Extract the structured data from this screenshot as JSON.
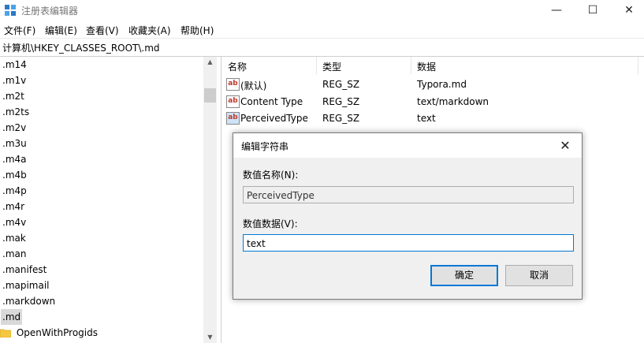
{
  "window": {
    "title": "注册表编辑器",
    "icons": {
      "app": "registry-editor-icon",
      "minimize": "minimize-icon",
      "maximize": "maximize-icon",
      "close": "close-icon"
    }
  },
  "menu": [
    "文件(F)",
    "编辑(E)",
    "查看(V)",
    "收藏夹(A)",
    "帮助(H)"
  ],
  "address": "计算机\\HKEY_CLASSES_ROOT\\.md",
  "tree": {
    "items": [
      ".m14",
      ".m1v",
      ".m2t",
      ".m2ts",
      ".m2v",
      ".m3u",
      ".m4a",
      ".m4b",
      ".m4p",
      ".m4r",
      ".m4v",
      ".mak",
      ".man",
      ".manifest",
      ".mapimail",
      ".markdown",
      ".md"
    ],
    "selected": ".md",
    "child": "OpenWithProgids",
    "folder_icon": "folder-icon"
  },
  "list": {
    "columns": [
      "名称",
      "类型",
      "数据"
    ],
    "rows": [
      {
        "name": "(默认)",
        "type": "REG_SZ",
        "data": "Typora.md",
        "icon": "string-value-icon"
      },
      {
        "name": "Content Type",
        "type": "REG_SZ",
        "data": "text/markdown",
        "icon": "string-value-icon"
      },
      {
        "name": "PerceivedType",
        "type": "REG_SZ",
        "data": "text",
        "icon": "string-value-icon"
      }
    ]
  },
  "dialog": {
    "title": "编辑字符串",
    "name_label": "数值名称(N):",
    "name_value": "PerceivedType",
    "data_label": "数值数据(V):",
    "data_value": "text",
    "ok": "确定",
    "cancel": "取消"
  }
}
